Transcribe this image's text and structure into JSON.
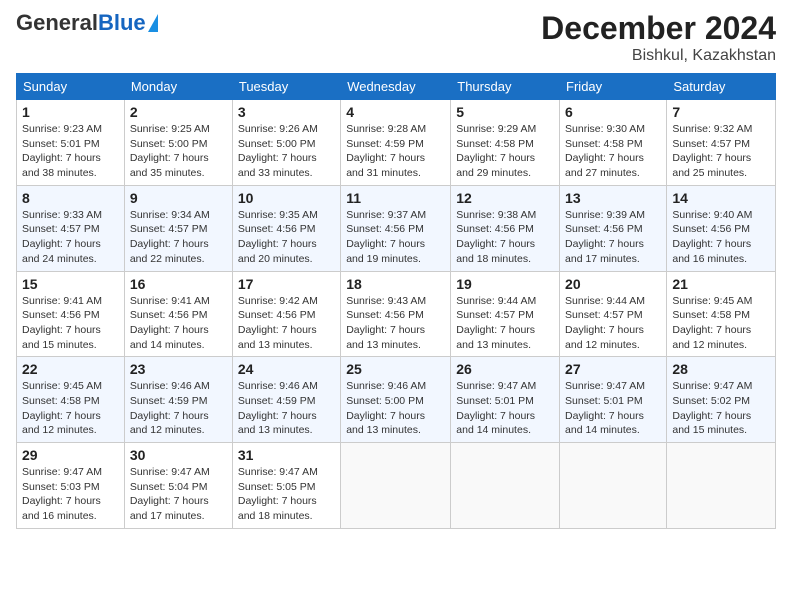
{
  "logo": {
    "general": "General",
    "blue": "Blue"
  },
  "header": {
    "month": "December 2024",
    "location": "Bishkul, Kazakhstan"
  },
  "weekdays": [
    "Sunday",
    "Monday",
    "Tuesday",
    "Wednesday",
    "Thursday",
    "Friday",
    "Saturday"
  ],
  "weeks": [
    [
      {
        "day": "1",
        "sunrise": "9:23 AM",
        "sunset": "5:01 PM",
        "daylight": "7 hours and 38 minutes."
      },
      {
        "day": "2",
        "sunrise": "9:25 AM",
        "sunset": "5:00 PM",
        "daylight": "7 hours and 35 minutes."
      },
      {
        "day": "3",
        "sunrise": "9:26 AM",
        "sunset": "5:00 PM",
        "daylight": "7 hours and 33 minutes."
      },
      {
        "day": "4",
        "sunrise": "9:28 AM",
        "sunset": "4:59 PM",
        "daylight": "7 hours and 31 minutes."
      },
      {
        "day": "5",
        "sunrise": "9:29 AM",
        "sunset": "4:58 PM",
        "daylight": "7 hours and 29 minutes."
      },
      {
        "day": "6",
        "sunrise": "9:30 AM",
        "sunset": "4:58 PM",
        "daylight": "7 hours and 27 minutes."
      },
      {
        "day": "7",
        "sunrise": "9:32 AM",
        "sunset": "4:57 PM",
        "daylight": "7 hours and 25 minutes."
      }
    ],
    [
      {
        "day": "8",
        "sunrise": "9:33 AM",
        "sunset": "4:57 PM",
        "daylight": "7 hours and 24 minutes."
      },
      {
        "day": "9",
        "sunrise": "9:34 AM",
        "sunset": "4:57 PM",
        "daylight": "7 hours and 22 minutes."
      },
      {
        "day": "10",
        "sunrise": "9:35 AM",
        "sunset": "4:56 PM",
        "daylight": "7 hours and 20 minutes."
      },
      {
        "day": "11",
        "sunrise": "9:37 AM",
        "sunset": "4:56 PM",
        "daylight": "7 hours and 19 minutes."
      },
      {
        "day": "12",
        "sunrise": "9:38 AM",
        "sunset": "4:56 PM",
        "daylight": "7 hours and 18 minutes."
      },
      {
        "day": "13",
        "sunrise": "9:39 AM",
        "sunset": "4:56 PM",
        "daylight": "7 hours and 17 minutes."
      },
      {
        "day": "14",
        "sunrise": "9:40 AM",
        "sunset": "4:56 PM",
        "daylight": "7 hours and 16 minutes."
      }
    ],
    [
      {
        "day": "15",
        "sunrise": "9:41 AM",
        "sunset": "4:56 PM",
        "daylight": "7 hours and 15 minutes."
      },
      {
        "day": "16",
        "sunrise": "9:41 AM",
        "sunset": "4:56 PM",
        "daylight": "7 hours and 14 minutes."
      },
      {
        "day": "17",
        "sunrise": "9:42 AM",
        "sunset": "4:56 PM",
        "daylight": "7 hours and 13 minutes."
      },
      {
        "day": "18",
        "sunrise": "9:43 AM",
        "sunset": "4:56 PM",
        "daylight": "7 hours and 13 minutes."
      },
      {
        "day": "19",
        "sunrise": "9:44 AM",
        "sunset": "4:57 PM",
        "daylight": "7 hours and 13 minutes."
      },
      {
        "day": "20",
        "sunrise": "9:44 AM",
        "sunset": "4:57 PM",
        "daylight": "7 hours and 12 minutes."
      },
      {
        "day": "21",
        "sunrise": "9:45 AM",
        "sunset": "4:58 PM",
        "daylight": "7 hours and 12 minutes."
      }
    ],
    [
      {
        "day": "22",
        "sunrise": "9:45 AM",
        "sunset": "4:58 PM",
        "daylight": "7 hours and 12 minutes."
      },
      {
        "day": "23",
        "sunrise": "9:46 AM",
        "sunset": "4:59 PM",
        "daylight": "7 hours and 12 minutes."
      },
      {
        "day": "24",
        "sunrise": "9:46 AM",
        "sunset": "4:59 PM",
        "daylight": "7 hours and 13 minutes."
      },
      {
        "day": "25",
        "sunrise": "9:46 AM",
        "sunset": "5:00 PM",
        "daylight": "7 hours and 13 minutes."
      },
      {
        "day": "26",
        "sunrise": "9:47 AM",
        "sunset": "5:01 PM",
        "daylight": "7 hours and 14 minutes."
      },
      {
        "day": "27",
        "sunrise": "9:47 AM",
        "sunset": "5:01 PM",
        "daylight": "7 hours and 14 minutes."
      },
      {
        "day": "28",
        "sunrise": "9:47 AM",
        "sunset": "5:02 PM",
        "daylight": "7 hours and 15 minutes."
      }
    ],
    [
      {
        "day": "29",
        "sunrise": "9:47 AM",
        "sunset": "5:03 PM",
        "daylight": "7 hours and 16 minutes."
      },
      {
        "day": "30",
        "sunrise": "9:47 AM",
        "sunset": "5:04 PM",
        "daylight": "7 hours and 17 minutes."
      },
      {
        "day": "31",
        "sunrise": "9:47 AM",
        "sunset": "5:05 PM",
        "daylight": "7 hours and 18 minutes."
      },
      null,
      null,
      null,
      null
    ]
  ],
  "labels": {
    "sunrise": "Sunrise:",
    "sunset": "Sunset:",
    "daylight": "Daylight:"
  }
}
